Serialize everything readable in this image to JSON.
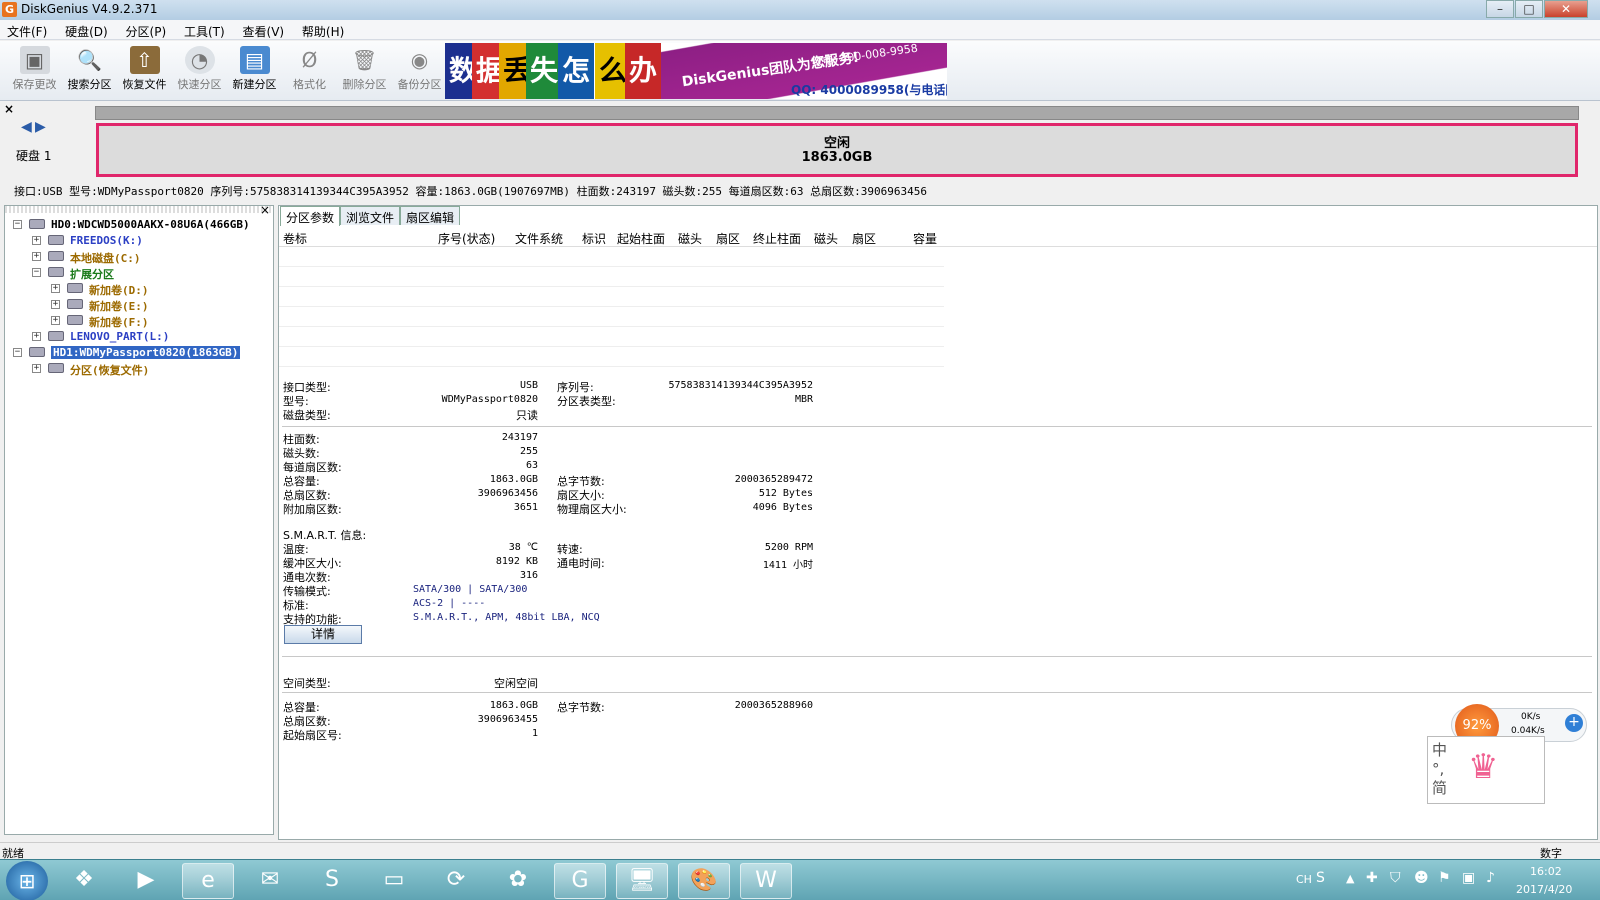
{
  "window": {
    "title": "DiskGenius V4.9.2.371",
    "app_icon": "G"
  },
  "menu": [
    "文件(F)",
    "硬盘(D)",
    "分区(P)",
    "工具(T)",
    "查看(V)",
    "帮助(H)"
  ],
  "toolbar": [
    {
      "label": "保存更改",
      "icon": "save-icon",
      "enabled": false
    },
    {
      "label": "搜索分区",
      "icon": "search-icon",
      "enabled": true
    },
    {
      "label": "恢复文件",
      "icon": "recover-icon",
      "enabled": true
    },
    {
      "label": "快速分区",
      "icon": "quick-partition-icon",
      "enabled": false
    },
    {
      "label": "新建分区",
      "icon": "new-partition-icon",
      "enabled": true
    },
    {
      "label": "格式化",
      "icon": "format-icon",
      "enabled": false
    },
    {
      "label": "删除分区",
      "icon": "delete-icon",
      "enabled": false
    },
    {
      "label": "备份分区",
      "icon": "backup-icon",
      "enabled": false
    }
  ],
  "banner": {
    "chars": [
      "数",
      "据",
      "丢",
      "失",
      "怎",
      "么",
      "办"
    ],
    "slogan": "DiskGenius团队为您服务!",
    "phone": "致电: 400-008-9958",
    "qq": "QQ: 4000089958(与电话同号)"
  },
  "disk_bar": {
    "close": "×",
    "disk_label": "硬盘 1",
    "region_label": "空闲",
    "region_size": "1863.0GB"
  },
  "info_line": "接口:USB  型号:WDMyPassport0820  序列号:575838314139344C395A3952  容量:1863.0GB(1907697MB)  柱面数:243197  磁头数:255  每道扇区数:63  总扇区数:3906963456",
  "tree": [
    {
      "text": "HD0:WDCWD5000AAKX-08U6A(466GB)",
      "level": 0,
      "exp": "−",
      "color": "#000000",
      "selected": false
    },
    {
      "text": "FREEDOS(K:)",
      "level": 1,
      "exp": "+",
      "color": "#2b3fc4",
      "selected": false
    },
    {
      "text": "本地磁盘(C:)",
      "level": 1,
      "exp": "+",
      "color": "#9c6a00",
      "selected": false
    },
    {
      "text": "扩展分区",
      "level": 1,
      "exp": "−",
      "color": "#1a7a1a",
      "selected": false
    },
    {
      "text": "新加卷(D:)",
      "level": 2,
      "exp": "+",
      "color": "#9c6a00",
      "selected": false
    },
    {
      "text": "新加卷(E:)",
      "level": 2,
      "exp": "+",
      "color": "#9c6a00",
      "selected": false
    },
    {
      "text": "新加卷(F:)",
      "level": 2,
      "exp": "+",
      "color": "#9c6a00",
      "selected": false
    },
    {
      "text": "LENOVO_PART(L:)",
      "level": 1,
      "exp": "+",
      "color": "#2b3fc4",
      "selected": false
    },
    {
      "text": "HD1:WDMyPassport0820(1863GB)",
      "level": 0,
      "exp": "−",
      "color": "#ffffff",
      "selected": true
    },
    {
      "text": "分区(恢复文件)",
      "level": 1,
      "exp": "+",
      "color": "#9c6a00",
      "selected": false
    }
  ],
  "tabs": [
    "分区参数",
    "浏览文件",
    "扇区编辑"
  ],
  "columns": [
    "卷标",
    "序号(状态)",
    "文件系统",
    "标识",
    "起始柱面",
    "磁头",
    "扇区",
    "终止柱面",
    "磁头",
    "扇区",
    "容量"
  ],
  "disk_info": {
    "interface_label": "接口类型:",
    "interface": "USB",
    "serial_label": "序列号:",
    "serial": "575838314139344C395A3952",
    "model_label": "型号:",
    "model": "WDMyPassport0820",
    "pt_label": "分区表类型:",
    "pt": "MBR",
    "type_label": "磁盘类型:",
    "type": "只读",
    "cyl_label": "柱面数:",
    "cyl": "243197",
    "heads_label": "磁头数:",
    "heads": "255",
    "spt_label": "每道扇区数:",
    "spt": "63",
    "cap_label": "总容量:",
    "cap": "1863.0GB",
    "bytes_label": "总字节数:",
    "bytes": "2000365289472",
    "sectors_label": "总扇区数:",
    "sectors": "3906963456",
    "ss_label": "扇区大小:",
    "ss": "512 Bytes",
    "extra_label": "附加扇区数:",
    "extra": "3651",
    "pss_label": "物理扇区大小:",
    "pss": "4096 Bytes"
  },
  "smart": {
    "title": "S.M.A.R.T. 信息:",
    "temp_label": "温度:",
    "temp": "38 ℃",
    "rpm_label": "转速:",
    "rpm": "5200 RPM",
    "cache_label": "缓冲区大小:",
    "cache": "8192 KB",
    "hours_label": "通电时间:",
    "hours": "1411 小时",
    "count_label": "通电次数:",
    "count": "316",
    "mode_label": "传输模式:",
    "mode": "SATA/300 | SATA/300",
    "std_label": "标准:",
    "std": "ACS-2 | ----",
    "feat_label": "支持的功能:",
    "feat": "S.M.A.R.T., APM, 48bit LBA, NCQ",
    "details_button": "详情"
  },
  "free_space": {
    "type_label": "空间类型:",
    "type": "空闲空间",
    "cap_label": "总容量:",
    "cap": "1863.0GB",
    "bytes_label": "总字节数:",
    "bytes": "2000365288960",
    "sectors_label": "总扇区数:",
    "sectors": "3906963455",
    "start_label": "起始扇区号:",
    "start": "1"
  },
  "status": {
    "left": "就绪",
    "right": "数字"
  },
  "widget": {
    "percent": "92%",
    "up": "0K/s",
    "down": "0.04K/s",
    "ime": "中 °, 简"
  },
  "tray": {
    "lang": "CH",
    "time": "16:02",
    "date": "2017/4/20"
  }
}
